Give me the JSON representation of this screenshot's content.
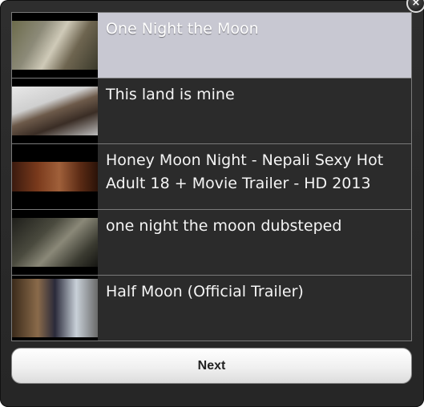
{
  "close_icon": "×",
  "videos": [
    {
      "title": "One Night the Moon",
      "selected": true
    },
    {
      "title": "This land is mine",
      "selected": false
    },
    {
      "title": "Honey Moon Night - Nepali Sexy Hot Adult 18 + Movie Trailer - HD 2013",
      "selected": false
    },
    {
      "title": "one night the moon dubsteped",
      "selected": false
    },
    {
      "title": "Half Moon (Official Trailer)",
      "selected": false
    }
  ],
  "next_label": "Next"
}
